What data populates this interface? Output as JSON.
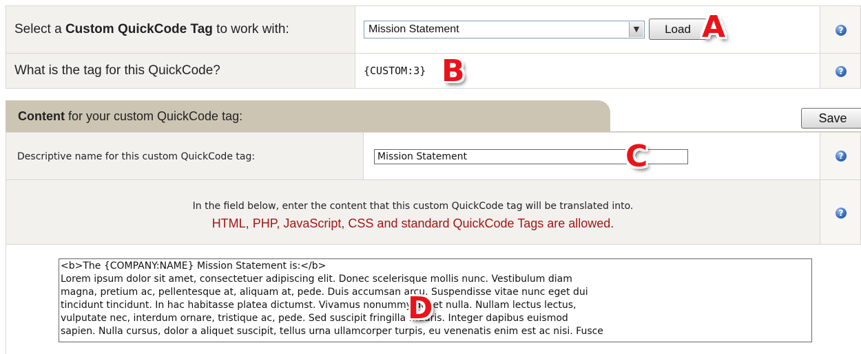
{
  "select_row": {
    "label_prefix": "Select a ",
    "label_bold": "Custom QuickCode Tag",
    "label_suffix": " to work with:",
    "selected": "Mission Statement",
    "load_label": "Load",
    "badge": "A"
  },
  "tag_row": {
    "label": "What is the tag for this QuickCode?",
    "value": "{CUSTOM:3}",
    "badge": "B"
  },
  "content_tab": {
    "title_bold": "Content",
    "title_rest": " for your custom QuickCode tag:",
    "save_label": "Save"
  },
  "name_row": {
    "label": "Descriptive name for this custom QuickCode tag:",
    "value": "Mission Statement",
    "badge": "C"
  },
  "instructions": {
    "line1": "In the field below, enter the content that this custom QuickCode tag will be translated into.",
    "line2": "HTML, PHP, JavaScript, CSS and standard QuickCode Tags are allowed."
  },
  "editor": {
    "lines": [
      "<b>The {COMPANY:NAME} Mission Statement is:</b>",
      "Lorem ipsum dolor sit amet, consectetuer adipiscing elit. Donec scelerisque mollis nunc. Vestibulum diam",
      "magna, pretium ac, pellentesque at, aliquam at, pede. Duis accumsan arcu. Suspendisse vitae nunc eget dui",
      "tincidunt tincidunt. In hac habitasse platea dictumst. Vivamus nonummy dui et nulla. Nullam lectus lectus,",
      "vulputate nec, interdum ornare, tristique ac, pede. Sed suscipit fringilla mauris. Integer dapibus euismod",
      "sapien. Nulla cursus, dolor a aliquet suscipit, tellus urna ullamcorper turpis, eu venenatis enim est ac nisi. Fusce"
    ],
    "badge": "D"
  },
  "help_glyph": "?",
  "colors": {
    "accent_red": "#a31515",
    "tab_bg": "#cdc5b4",
    "label_bg": "#f2f1ee",
    "help_blue": "#3a6fbf"
  }
}
